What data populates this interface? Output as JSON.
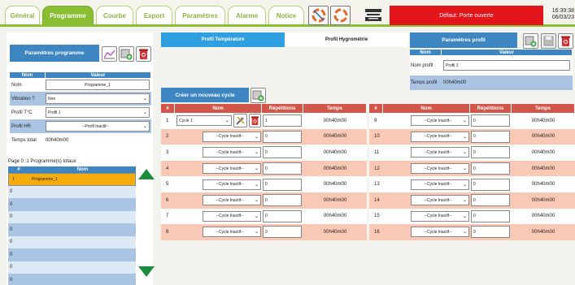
{
  "tabs": [
    "Général",
    "Programme",
    "Courbe",
    "Export",
    "Paramètres",
    "Alarme",
    "Notice"
  ],
  "active_tab": 1,
  "alarm": "Défaut: Porte ouverte",
  "clock": {
    "time": "16:39:38",
    "date": "06/03/23"
  },
  "colors": {
    "green": "#8bbe33",
    "blue": "#3e86c2",
    "red_header": "#d2574a",
    "alarm": "#e3151b",
    "orange": "#f5ad0e"
  },
  "left": {
    "title": "Paramètres programme",
    "headers": {
      "name": "Nom",
      "value": "Valeur"
    },
    "rows": {
      "name": {
        "label": "Nom",
        "value": "Programme_1"
      },
      "vibration": {
        "label": "Vibration ?",
        "value": "Non"
      },
      "profile_t": {
        "label": "Profil T°C",
        "value": "Profil 1"
      },
      "profile_hr": {
        "label": "Profil HR",
        "value": "--Profil Inactif--"
      },
      "total": {
        "label": "Temps total",
        "value": "00h40m00"
      }
    },
    "page_info": "Page 0 :1 Programme(s) totaux",
    "prog_headers": {
      "num": "#",
      "name": "Nom"
    },
    "programs": [
      {
        "num": "1",
        "name": "Programme_1"
      },
      {
        "num": "0",
        "name": ""
      },
      {
        "num": "0",
        "name": ""
      },
      {
        "num": "0",
        "name": ""
      },
      {
        "num": "0",
        "name": ""
      },
      {
        "num": "0",
        "name": ""
      },
      {
        "num": "0",
        "name": ""
      },
      {
        "num": "0",
        "name": ""
      },
      {
        "num": "0",
        "name": ""
      }
    ]
  },
  "profile_tabs": {
    "temp": "Profil Température",
    "hygro": "Profil Hygrométrie"
  },
  "profile_params": {
    "title": "Paramètres profil",
    "headers": {
      "name": "Nom",
      "value": "Valeur"
    },
    "name_label": "Nom profil",
    "name_value": "Profil 1",
    "time_label": "Temps profil",
    "time_value": "00h40m00"
  },
  "create_cycle": "Créer un nouveau cycle",
  "cycle_headers": {
    "num": "#",
    "name": "Nom",
    "rep": "Répétitions",
    "time": "Temps"
  },
  "cycles_left": [
    {
      "num": "1",
      "cycle": "Cycle 1",
      "rep": "1",
      "time": "00h40m00"
    },
    {
      "num": "2",
      "cycle": "--Cycle Inactif--",
      "rep": "0",
      "time": "00h40m00"
    },
    {
      "num": "3",
      "cycle": "--Cycle Inactif--",
      "rep": "0",
      "time": "00h40m00"
    },
    {
      "num": "4",
      "cycle": "--Cycle Inactif--",
      "rep": "0",
      "time": "00h40m00"
    },
    {
      "num": "5",
      "cycle": "--Cycle Inactif--",
      "rep": "0",
      "time": "00h40m00"
    },
    {
      "num": "6",
      "cycle": "--Cycle Inactif--",
      "rep": "0",
      "time": "00h40m00"
    },
    {
      "num": "7",
      "cycle": "--Cycle Inactif--",
      "rep": "0",
      "time": "00h40m00"
    },
    {
      "num": "8",
      "cycle": "--Cycle Inactif--",
      "rep": "0",
      "time": "00h40m00"
    }
  ],
  "cycles_right": [
    {
      "num": "9",
      "cycle": "--Cycle Inactif--",
      "rep": "0",
      "time": "00h40m00"
    },
    {
      "num": "10",
      "cycle": "--Cycle Inactif--",
      "rep": "0",
      "time": "00h40m00"
    },
    {
      "num": "11",
      "cycle": "--Cycle Inactif--",
      "rep": "0",
      "time": "00h40m00"
    },
    {
      "num": "12",
      "cycle": "--Cycle Inactif--",
      "rep": "0",
      "time": "00h40m00"
    },
    {
      "num": "13",
      "cycle": "--Cycle Inactif--",
      "rep": "0",
      "time": "00h40m00"
    },
    {
      "num": "14",
      "cycle": "--Cycle Inactif--",
      "rep": "0",
      "time": "00h40m00"
    },
    {
      "num": "15",
      "cycle": "--Cycle Inactif--",
      "rep": "0",
      "time": "00h40m00"
    },
    {
      "num": "16",
      "cycle": "--Cycle Inactif--",
      "rep": "0",
      "time": "00h40m00"
    }
  ]
}
